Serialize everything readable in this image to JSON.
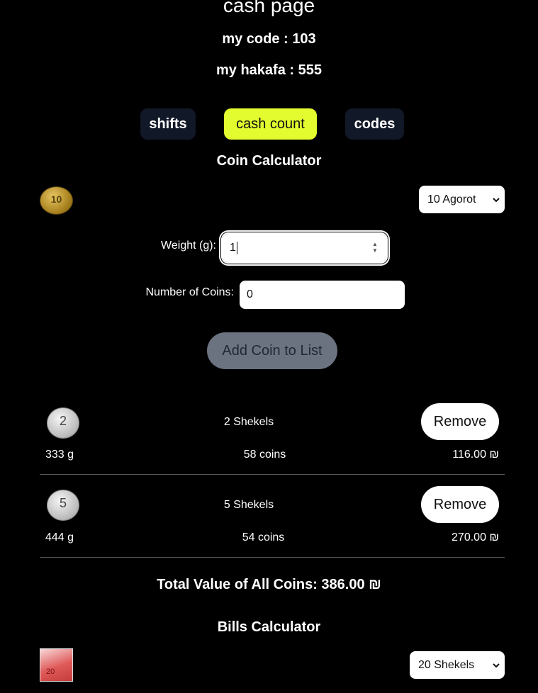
{
  "header": {
    "title": "cash page",
    "my_code": "my code : 103",
    "my_hakafa": "my hakafa : 555"
  },
  "nav": {
    "shifts": "shifts",
    "cash_count": "cash count",
    "codes": "codes",
    "active_color": "#e2fc2f"
  },
  "coin_calculator": {
    "heading": "Coin Calculator",
    "coin_type_selected": "10 Agorot",
    "coin_image_label": "10",
    "weight_label": "Weight (g):",
    "weight_value": "1",
    "count_label": "Number of Coins:",
    "count_value": "0",
    "add_button": "Add Coin to List",
    "items": [
      {
        "name": "2 Shekels",
        "coin_glyph": "2",
        "weight": "333 g",
        "count": "58 coins",
        "value": "116.00 ₪",
        "remove": "Remove"
      },
      {
        "name": "5 Shekels",
        "coin_glyph": "5",
        "weight": "444 g",
        "count": "54 coins",
        "value": "270.00 ₪",
        "remove": "Remove"
      }
    ],
    "total": "Total Value of All Coins: 386.00 ₪"
  },
  "bills_calculator": {
    "heading": "Bills Calculator",
    "bill_type_selected": "20 Shekels",
    "bill_image_label": "20"
  }
}
